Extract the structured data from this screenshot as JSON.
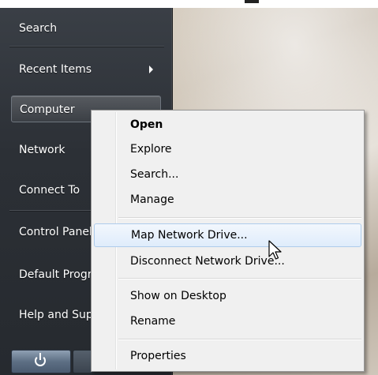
{
  "start_menu": {
    "items": [
      {
        "label": "Search"
      },
      {
        "label": "Recent Items"
      },
      {
        "label": "Computer"
      },
      {
        "label": "Network"
      },
      {
        "label": "Connect To"
      },
      {
        "label": "Control Panel"
      },
      {
        "label": "Default Programs"
      },
      {
        "label": "Help and Support"
      }
    ],
    "power_icon": "power-icon",
    "submenu_arrow_icon": "triangle-right-icon"
  },
  "context_menu": {
    "items": [
      {
        "label": "Open"
      },
      {
        "label": "Explore"
      },
      {
        "label": "Search..."
      },
      {
        "label": "Manage"
      },
      {
        "label": "Map Network Drive..."
      },
      {
        "label": "Disconnect Network Drive..."
      },
      {
        "label": "Show on Desktop"
      },
      {
        "label": "Rename"
      },
      {
        "label": "Properties"
      }
    ],
    "highlight_color": "#dfecfb",
    "cursor_icon": "arrow-cursor-icon"
  }
}
